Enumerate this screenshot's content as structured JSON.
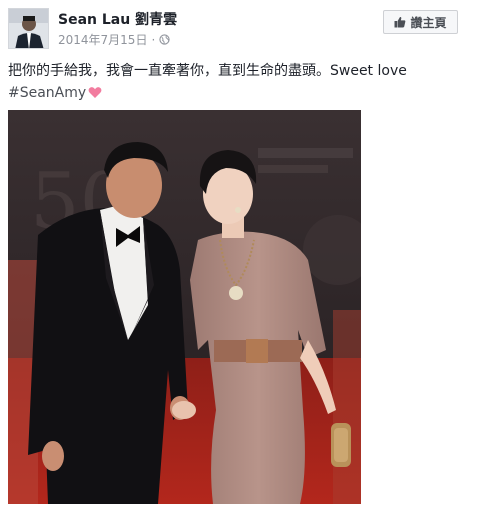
{
  "post": {
    "author": "Sean Lau 劉青雲",
    "date": "2014年7月15日",
    "meta_separator": "·",
    "privacy_icon": "globe-icon",
    "like_page_label": "讚主頁",
    "like_page_icon": "thumbs-up-icon",
    "text_line1": "把你的手給我，我會一直牽著你，直到生命的盡頭。Sweet love",
    "hashtag": "#SeanAmy",
    "heart_icon": "heart-icon",
    "colors": {
      "author_text": "#1d2129",
      "meta_text": "#90949c",
      "heart": "#f27c9f",
      "button_bg": "#f6f7f9",
      "button_border": "#ced0d4"
    }
  }
}
